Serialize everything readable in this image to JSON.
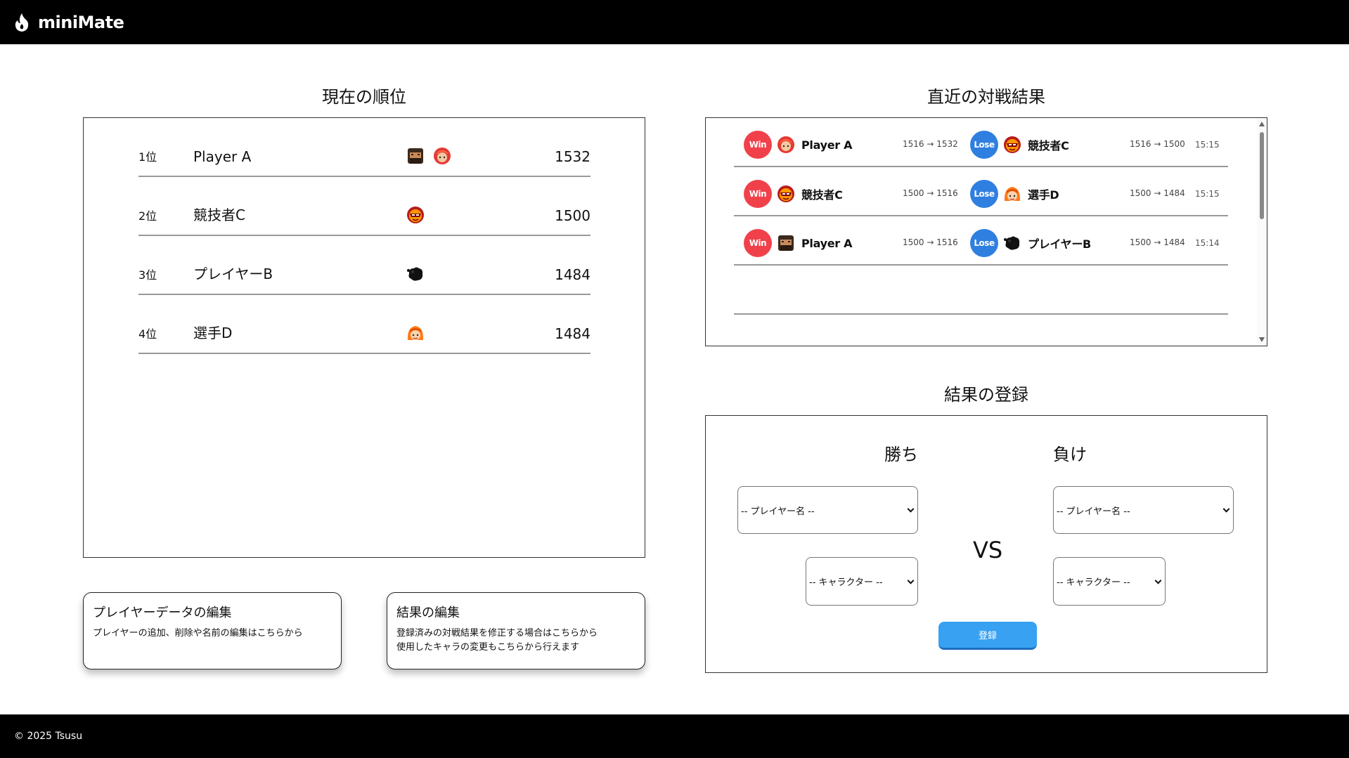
{
  "app": {
    "title": "miniMate",
    "logo_icon": "flame-icon"
  },
  "footer": {
    "copyright": "© 2025 Tsusu"
  },
  "ranking": {
    "title": "現在の順位",
    "rows": [
      {
        "position": "1位",
        "name": "Player A",
        "characters": [
          "bearded-fighter-icon",
          "red-hair-fighter-icon"
        ],
        "rating": "1532"
      },
      {
        "position": "2位",
        "name": "競技者C",
        "characters": [
          "red-masked-fighter-icon"
        ],
        "rating": "1500"
      },
      {
        "position": "3位",
        "name": "プレイヤーB",
        "characters": [
          "black-blob-icon"
        ],
        "rating": "1484"
      },
      {
        "position": "4位",
        "name": "選手D",
        "characters": [
          "orange-hair-fighter-icon"
        ],
        "rating": "1484"
      }
    ]
  },
  "edit_player": {
    "title": "プレイヤーデータの編集",
    "description": "プレイヤーの追加、削除や名前の編集はこちらから"
  },
  "edit_results": {
    "title": "結果の編集",
    "description": "登録済みの対戦結果を修正する場合はこちらから\n使用したキャラの変更もこちらから行えます"
  },
  "recent": {
    "title": "直近の対戦結果",
    "matches": [
      {
        "winner": {
          "badge": "Win",
          "character": "red-hair-fighter-icon",
          "name": "Player A",
          "rate": "1516 → 1532"
        },
        "loser": {
          "badge": "Lose",
          "character": "red-masked-fighter-icon",
          "name": "競技者C",
          "rate": "1516 → 1500"
        },
        "time": "15:15"
      },
      {
        "winner": {
          "badge": "Win",
          "character": "red-masked-fighter-icon",
          "name": "競技者C",
          "rate": "1500 → 1516"
        },
        "loser": {
          "badge": "Lose",
          "character": "orange-hair-fighter-icon",
          "name": "選手D",
          "rate": "1500 → 1484"
        },
        "time": "15:15"
      },
      {
        "winner": {
          "badge": "Win",
          "character": "bearded-fighter-icon",
          "name": "Player A",
          "rate": "1500 → 1516"
        },
        "loser": {
          "badge": "Lose",
          "character": "black-blob-icon",
          "name": "プレイヤーB",
          "rate": "1500 → 1484"
        },
        "time": "15:14"
      }
    ]
  },
  "register": {
    "title": "結果の登録",
    "winner_label": "勝ち",
    "loser_label": "負け",
    "vs_label": "VS",
    "winner_player_select": "-- プレイヤー名 --",
    "winner_character_select": "-- キャラクター --",
    "loser_player_select": "-- プレイヤー名 --",
    "loser_character_select": "-- キャラクター --",
    "submit_label": "登録"
  },
  "colors": {
    "win": "#f0414b",
    "lose": "#2f7fe0",
    "button": "#38a1f2",
    "header": "#000000"
  }
}
